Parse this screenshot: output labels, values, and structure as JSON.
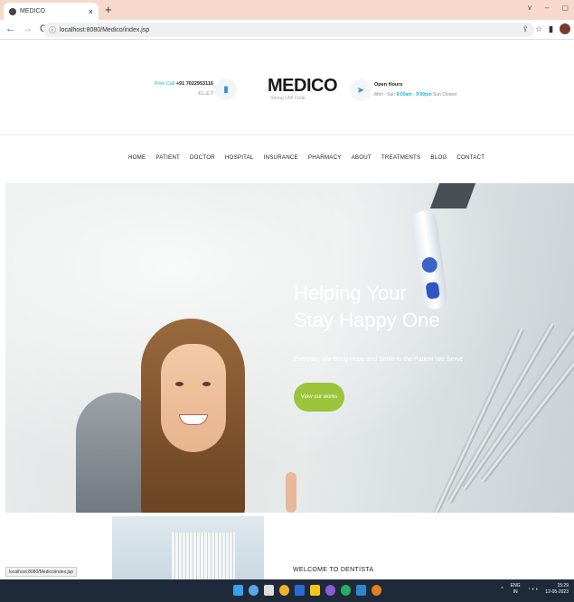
{
  "browser": {
    "tab_title": "MEDICO",
    "tab_close": "×",
    "new_tab": "+",
    "url": "localhost:8080/Medico/index.jsp",
    "status_url": "localhost:8080/Medico/index.jsp",
    "window_controls": [
      "∨",
      "–",
      "▢"
    ]
  },
  "header": {
    "call_label": "Free Call",
    "call_number": "+91 7022953116",
    "call_sub": "K.L.E.T",
    "logo": "MEDICO",
    "tagline": "Strong UMI Code",
    "hours_title": "Open Hours",
    "hours_prefix": "Mon - Sat:",
    "hours_time": "9:00am - 9:00pm",
    "hours_suffix": "Sun Closed"
  },
  "nav": {
    "items": [
      "HOME",
      "PATIENT",
      "DOCTOR",
      "HOSPITAL",
      "INSURANCE",
      "PHARMACY",
      "ABOUT",
      "TREATMENTS",
      "BLOG",
      "CONTACT"
    ]
  },
  "hero": {
    "title_line1": "Helping Your",
    "title_line2": "Stay Happy One",
    "subtitle": "Everyday We Bring Hope and Smile to the Patient We Serve",
    "button": "View our works",
    "button_color": "#9bc43a"
  },
  "section": {
    "welcome": "WELCOME TO DENTISTA"
  },
  "taskbar": {
    "lang_top": "ENG",
    "lang_bottom": "IN",
    "time": "15:29",
    "date": "12-05-2023"
  },
  "colors": {
    "accent": "#1bb7d6",
    "tab_strip": "#f7d9cc"
  }
}
